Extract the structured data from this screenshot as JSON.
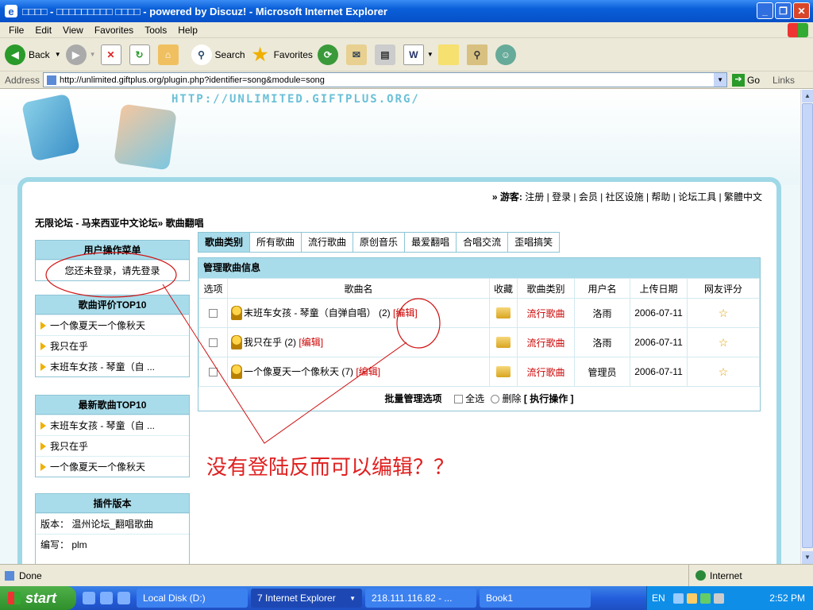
{
  "window": {
    "title": "□□□□ - □□□□□□□□□ □□□□ - powered by Discuz! - Microsoft Internet Explorer"
  },
  "menu": [
    "File",
    "Edit",
    "View",
    "Favorites",
    "Tools",
    "Help"
  ],
  "toolbar": {
    "back": "Back",
    "search": "Search",
    "favorites": "Favorites"
  },
  "address": {
    "label": "Address",
    "url": "http://unlimited.giftplus.org/plugin.php?identifier=song&module=song",
    "go": "Go",
    "links": "Links"
  },
  "banner": {
    "url": "HTTP://UNLIMITED.GIFTPLUS.ORG/"
  },
  "toplinks": {
    "guest": "» 游客:",
    "items": "注册 | 登录 | 会员 | 社区设施 | 帮助 | 论坛工具 | 繁體中文"
  },
  "breadcrumb": "无限论坛 - 马来西亚中文论坛» 歌曲翻唱",
  "sidebar": {
    "user_menu": {
      "title": "用户操作菜单",
      "text": "您还未登录，请先登录"
    },
    "top_rated": {
      "title": "歌曲评价TOP10",
      "items": [
        "一个像夏天一个像秋天",
        "我只在乎",
        "末班车女孩 - 琴童（自 ..."
      ]
    },
    "newest": {
      "title": "最新歌曲TOP10",
      "items": [
        "末班车女孩 - 琴童（自 ...",
        "我只在乎",
        "一个像夏天一个像秋天"
      ]
    },
    "version": {
      "title": "插件版本",
      "version": "版本： 温州论坛_翻唱歌曲",
      "author": "编写： plm"
    }
  },
  "tabs": [
    "歌曲类别",
    "所有歌曲",
    "流行歌曲",
    "原创音乐",
    "最爱翻唱",
    "合唱交流",
    "歪唱搞笑"
  ],
  "panel": {
    "title": "管理歌曲信息",
    "columns": [
      "选项",
      "歌曲名",
      "收藏",
      "歌曲类别",
      "用户名",
      "上传日期",
      "网友评分"
    ],
    "rows": [
      {
        "name": "末班车女孩 - 琴童（自弹自唱）",
        "count": "(2)",
        "edit": "[编辑]",
        "category": "流行歌曲",
        "user": "洛雨",
        "date": "2006-07-11"
      },
      {
        "name": "我只在乎",
        "count": "(2)",
        "edit": "[编辑]",
        "category": "流行歌曲",
        "user": "洛雨",
        "date": "2006-07-11"
      },
      {
        "name": "一个像夏天一个像秋天",
        "count": "(7)",
        "edit": "[编辑]",
        "category": "流行歌曲",
        "user": "管理员",
        "date": "2006-07-11"
      }
    ],
    "batch": {
      "label": "批量管理选项",
      "select_all": "全选",
      "delete": "删除",
      "execute": "[ 执行操作 ]"
    }
  },
  "annotation": "没有登陆反而可以编辑？？",
  "status": {
    "done": "Done",
    "zone": "Internet"
  },
  "taskbar": {
    "start": "start",
    "tasks": [
      "Local Disk (D:)",
      "7 Internet Explorer",
      "218.111.116.82 - ...",
      "Book1"
    ],
    "lang": "EN",
    "clock": "2:52 PM"
  }
}
